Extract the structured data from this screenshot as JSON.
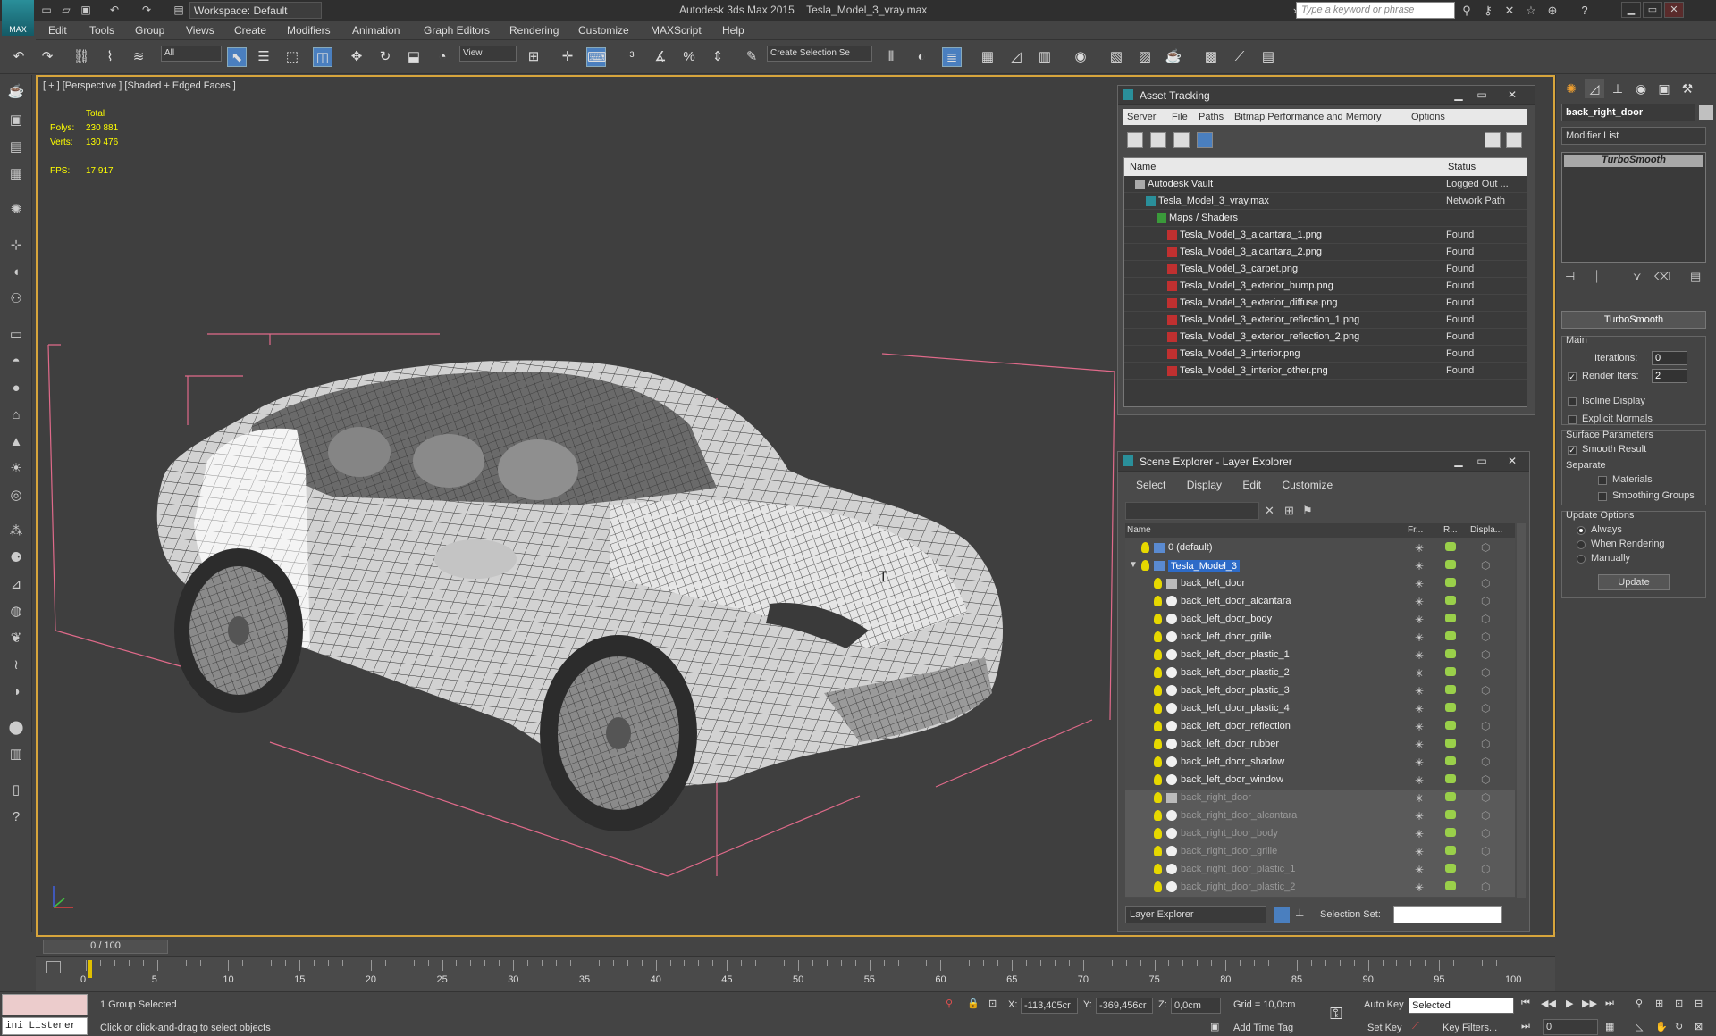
{
  "title": {
    "app": "Autodesk 3ds Max 2015",
    "file": "Tesla_Model_3_vray.max",
    "workspace": "Workspace: Default",
    "search_placeholder": "Type a keyword or phrase",
    "logo": "MAX"
  },
  "menu": [
    "Edit",
    "Tools",
    "Group",
    "Views",
    "Create",
    "Modifiers",
    "Animation",
    "Graph Editors",
    "Rendering",
    "Customize",
    "MAXScript",
    "Help"
  ],
  "toolbar": {
    "selection_filter": "All",
    "ref_coord": "View",
    "named_selection": "Create Selection Se"
  },
  "viewport": {
    "label": "[ + ] [Perspective ] [Shaded + Edged Faces ]",
    "stats": {
      "total_label": "Total",
      "polys_label": "Polys:",
      "polys": "230 881",
      "verts_label": "Verts:",
      "verts": "130 476",
      "fps_label": "FPS:",
      "fps": "17,917"
    }
  },
  "asset_tracking": {
    "title": "Asset Tracking",
    "menu": [
      "Server",
      "File",
      "Paths",
      "Bitmap Performance and Memory",
      "Options"
    ],
    "col_name": "Name",
    "col_status": "Status",
    "rows": [
      {
        "name": "Autodesk Vault",
        "status": "Logged Out ...",
        "level": 0,
        "icon": "vault"
      },
      {
        "name": "Tesla_Model_3_vray.max",
        "status": "Network Path",
        "level": 1,
        "icon": "max"
      },
      {
        "name": "Maps / Shaders",
        "status": "",
        "level": 2,
        "icon": "maps"
      },
      {
        "name": "Tesla_Model_3_alcantara_1.png",
        "status": "Found",
        "level": 3,
        "icon": "png"
      },
      {
        "name": "Tesla_Model_3_alcantara_2.png",
        "status": "Found",
        "level": 3,
        "icon": "png"
      },
      {
        "name": "Tesla_Model_3_carpet.png",
        "status": "Found",
        "level": 3,
        "icon": "png"
      },
      {
        "name": "Tesla_Model_3_exterior_bump.png",
        "status": "Found",
        "level": 3,
        "icon": "png"
      },
      {
        "name": "Tesla_Model_3_exterior_diffuse.png",
        "status": "Found",
        "level": 3,
        "icon": "png"
      },
      {
        "name": "Tesla_Model_3_exterior_reflection_1.png",
        "status": "Found",
        "level": 3,
        "icon": "png"
      },
      {
        "name": "Tesla_Model_3_exterior_reflection_2.png",
        "status": "Found",
        "level": 3,
        "icon": "png"
      },
      {
        "name": "Tesla_Model_3_interior.png",
        "status": "Found",
        "level": 3,
        "icon": "png"
      },
      {
        "name": "Tesla_Model_3_interior_other.png",
        "status": "Found",
        "level": 3,
        "icon": "png"
      }
    ]
  },
  "scene_explorer": {
    "title": "Scene Explorer - Layer Explorer",
    "menu": [
      "Select",
      "Display",
      "Edit",
      "Customize"
    ],
    "col_name": "Name",
    "col_frozen": "Fr...",
    "col_render": "R...",
    "col_display": "Displa...",
    "rows": [
      {
        "name": "0 (default)",
        "level": 0,
        "type": "layer",
        "state": "normal"
      },
      {
        "name": "Tesla_Model_3",
        "level": 0,
        "type": "layer",
        "state": "selected"
      },
      {
        "name": "back_left_door",
        "level": 1,
        "type": "group",
        "state": "normal"
      },
      {
        "name": "back_left_door_alcantara",
        "level": 1,
        "type": "obj",
        "state": "normal"
      },
      {
        "name": "back_left_door_body",
        "level": 1,
        "type": "obj",
        "state": "normal"
      },
      {
        "name": "back_left_door_grille",
        "level": 1,
        "type": "obj",
        "state": "normal"
      },
      {
        "name": "back_left_door_plastic_1",
        "level": 1,
        "type": "obj",
        "state": "normal"
      },
      {
        "name": "back_left_door_plastic_2",
        "level": 1,
        "type": "obj",
        "state": "normal"
      },
      {
        "name": "back_left_door_plastic_3",
        "level": 1,
        "type": "obj",
        "state": "normal"
      },
      {
        "name": "back_left_door_plastic_4",
        "level": 1,
        "type": "obj",
        "state": "normal"
      },
      {
        "name": "back_left_door_reflection",
        "level": 1,
        "type": "obj",
        "state": "normal"
      },
      {
        "name": "back_left_door_rubber",
        "level": 1,
        "type": "obj",
        "state": "normal"
      },
      {
        "name": "back_left_door_shadow",
        "level": 1,
        "type": "obj",
        "state": "normal"
      },
      {
        "name": "back_left_door_window",
        "level": 1,
        "type": "obj",
        "state": "normal"
      },
      {
        "name": "back_right_door",
        "level": 1,
        "type": "group",
        "state": "dim"
      },
      {
        "name": "back_right_door_alcantara",
        "level": 1,
        "type": "obj",
        "state": "dim"
      },
      {
        "name": "back_right_door_body",
        "level": 1,
        "type": "obj",
        "state": "dim"
      },
      {
        "name": "back_right_door_grille",
        "level": 1,
        "type": "obj",
        "state": "dim"
      },
      {
        "name": "back_right_door_plastic_1",
        "level": 1,
        "type": "obj",
        "state": "dim"
      },
      {
        "name": "back_right_door_plastic_2",
        "level": 1,
        "type": "obj",
        "state": "dim"
      }
    ],
    "footer_mode": "Layer Explorer",
    "selection_set_label": "Selection Set:"
  },
  "command_panel": {
    "object_name": "back_right_door",
    "modifier_list": "Modifier List",
    "stack_item": "TurboSmooth",
    "rollout_title": "TurboSmooth",
    "main_label": "Main",
    "iterations_label": "Iterations:",
    "iterations": "0",
    "render_iters_label": "Render Iters:",
    "render_iters": "2",
    "isoline_label": "Isoline Display",
    "explicit_normals_label": "Explicit Normals",
    "surface_params_label": "Surface Parameters",
    "smooth_result_label": "Smooth Result",
    "separate_label": "Separate",
    "materials_label": "Materials",
    "smoothing_groups_label": "Smoothing Groups",
    "update_options_label": "Update Options",
    "always_label": "Always",
    "when_rendering_label": "When Rendering",
    "manually_label": "Manually",
    "update_button": "Update"
  },
  "timeline": {
    "frame_display": "0 / 100",
    "ticks": [
      "0",
      "5",
      "10",
      "15",
      "20",
      "25",
      "30",
      "35",
      "40",
      "45",
      "50",
      "55",
      "60",
      "65",
      "70",
      "75",
      "80",
      "85",
      "90",
      "95",
      "100"
    ]
  },
  "status_bar": {
    "listener": "ini Listener",
    "selection": "1 Group Selected",
    "prompt": "Click or click-and-drag to select objects",
    "x_label": "X:",
    "x": "-113,405cr",
    "y_label": "Y:",
    "y": "-369,456cr",
    "z_label": "Z:",
    "z": "0,0cm",
    "grid": "Grid = 10,0cm",
    "auto_key": "Auto Key",
    "auto_key_mode": "Selected",
    "set_key": "Set Key",
    "key_filters": "Key Filters...",
    "add_time_tag": "Add Time Tag",
    "frame": "0"
  },
  "colors": {
    "viewport_border": "#d7a53c",
    "selection_blue": "#2d6bc8",
    "stats_yellow": "#ffff00",
    "bbox_pink": "#e06a8a"
  }
}
